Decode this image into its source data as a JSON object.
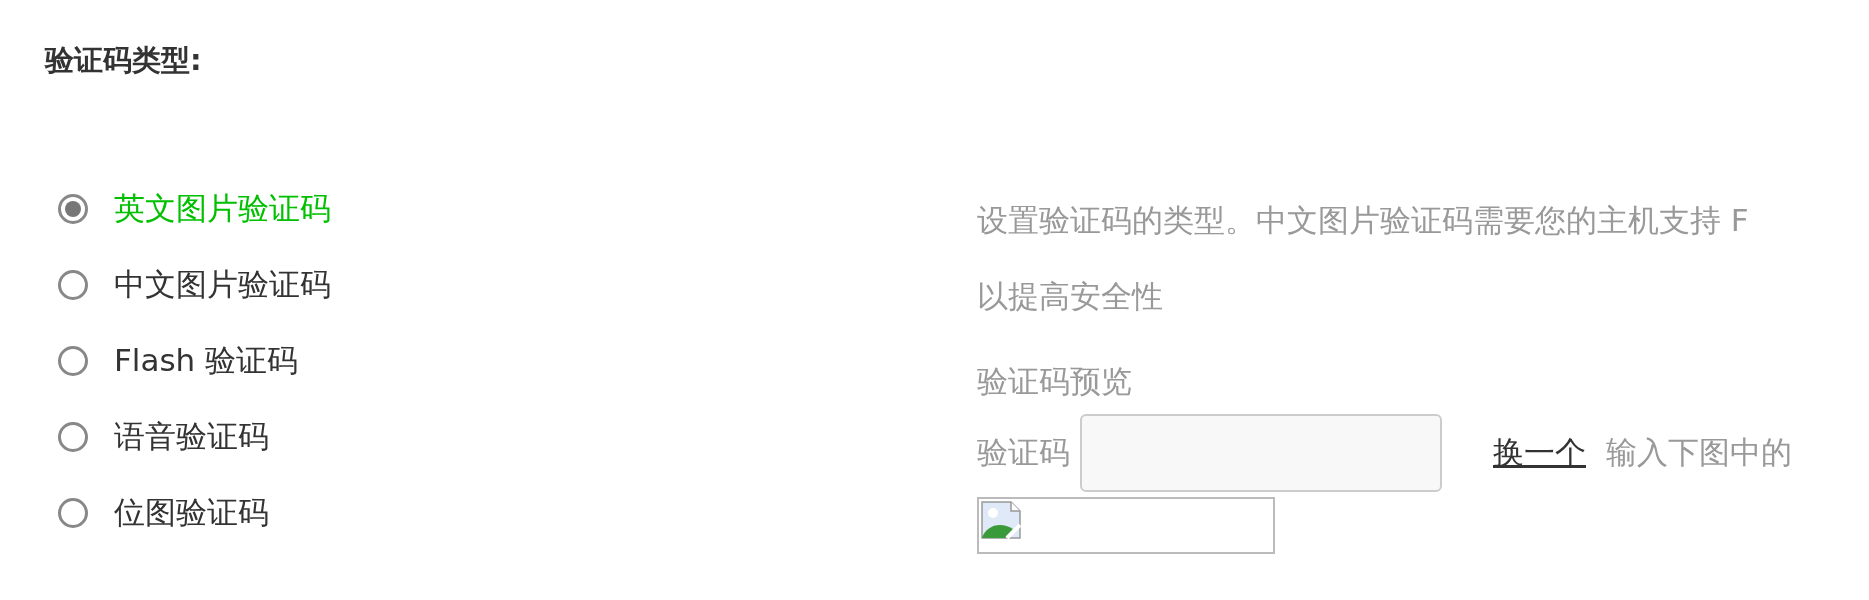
{
  "section_title": "验证码类型:",
  "options": [
    {
      "label": "英文图片验证码",
      "selected": true
    },
    {
      "label": "中文图片验证码",
      "selected": false
    },
    {
      "label": "Flash 验证码",
      "selected": false
    },
    {
      "label": "语音验证码",
      "selected": false
    },
    {
      "label": "位图验证码",
      "selected": false
    }
  ],
  "description": [
    "设置验证码的类型。中文图片验证码需要您的主机支持 F",
    "以提高安全性"
  ],
  "preview": {
    "heading": "验证码预览",
    "field_label": "验证码",
    "refresh_link": "换一个",
    "hint": "输入下图中的"
  }
}
